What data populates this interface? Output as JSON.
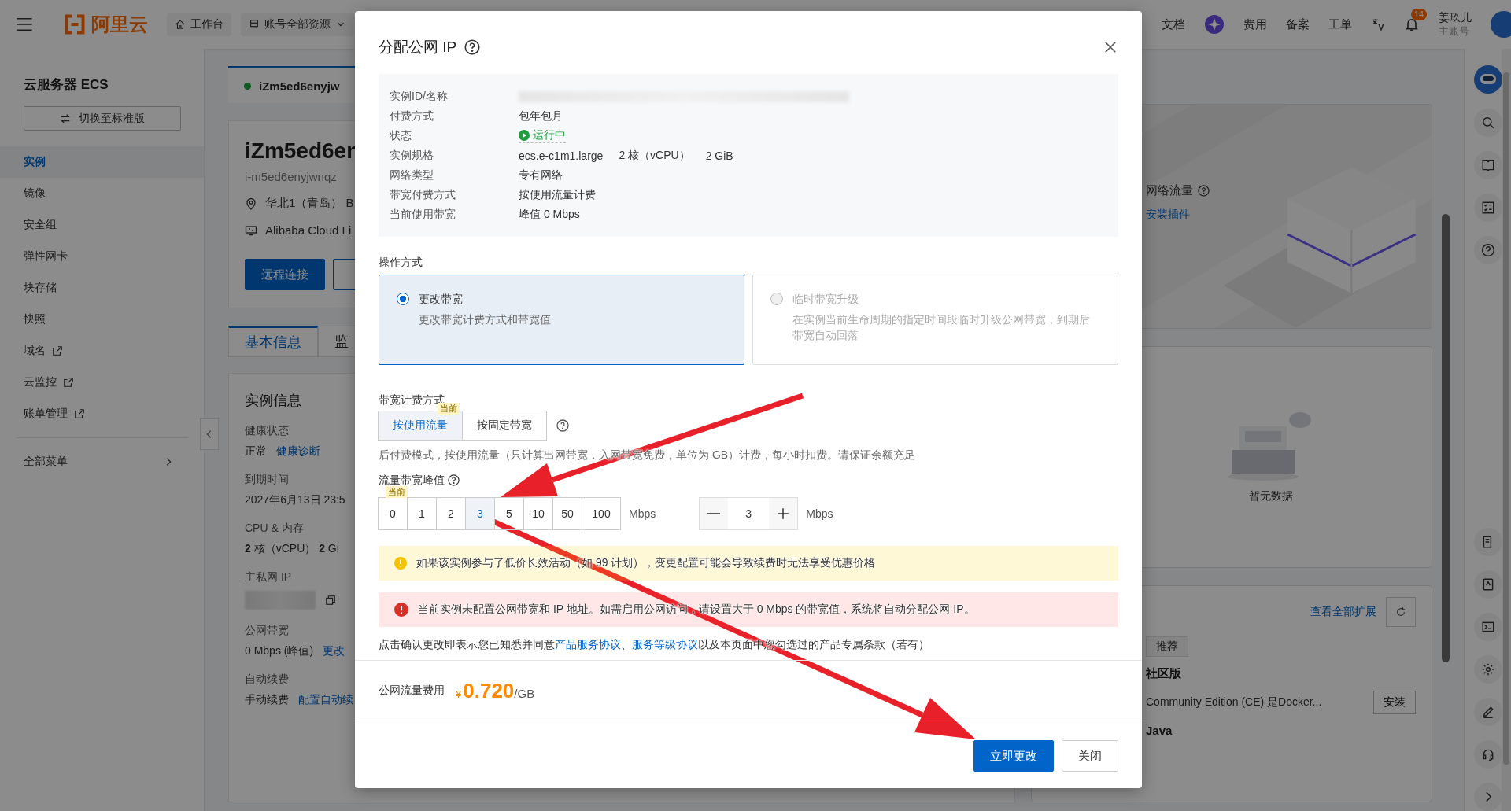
{
  "topbar": {
    "logo": "阿里云",
    "nav": [
      {
        "label": "工作台",
        "kind": "home"
      },
      {
        "label": "账号全部资源",
        "kind": "resources"
      }
    ],
    "links": [
      "文档",
      "费用",
      "备案",
      "工单"
    ],
    "notification_count": "14",
    "user": {
      "name": "姜玖儿",
      "role": "主账号"
    }
  },
  "sidebar": {
    "title": "云服务器 ECS",
    "switch_button": "切换至标准版",
    "items": [
      {
        "label": "实例",
        "selected": true,
        "external": false
      },
      {
        "label": "镜像",
        "selected": false,
        "external": false
      },
      {
        "label": "安全组",
        "selected": false,
        "external": false
      },
      {
        "label": "弹性网卡",
        "selected": false,
        "external": false
      },
      {
        "label": "块存储",
        "selected": false,
        "external": false
      },
      {
        "label": "快照",
        "selected": false,
        "external": false
      },
      {
        "label": "域名",
        "selected": false,
        "external": true
      },
      {
        "label": "云监控",
        "selected": false,
        "external": true
      },
      {
        "label": "账单管理",
        "selected": false,
        "external": true
      }
    ],
    "all_menu": "全部菜单"
  },
  "instance": {
    "tab_title": "iZm5ed6enyjw",
    "name": "iZm5ed6en",
    "id": "i-m5ed6enyjwnqz",
    "region": "华北1（青岛） B",
    "os": "Alibaba Cloud Li",
    "connect_button": "远程连接",
    "tabs": [
      {
        "label": "基本信息",
        "selected": true
      },
      {
        "label": "监",
        "selected": false
      }
    ],
    "info": {
      "title": "实例信息",
      "fields": [
        {
          "label": "健康状态",
          "value": "正常",
          "link": "健康诊断"
        },
        {
          "label": "到期时间",
          "value": "2027年6月13日 23:5"
        },
        {
          "label": "CPU & 内存",
          "value": "**2** 核（vCPU）  **2** Gi"
        },
        {
          "label": "主私网 IP",
          "kind": "blurred"
        },
        {
          "label": "公网带宽",
          "value": "0 Mbps (峰值)",
          "link": "更改"
        },
        {
          "label": "自动续费",
          "value": "手动续费",
          "link": "配置自动续"
        }
      ]
    }
  },
  "right": {
    "monitor": {
      "title": "网络流量",
      "link": "安装插件"
    },
    "empty": "暂无数据",
    "extensions": {
      "link": "查看全部扩展",
      "tag": "推荐",
      "items": [
        {
          "title": "社区版",
          "desc": "Community Edition (CE) 是Docker...",
          "button": "安装"
        },
        {
          "title": "Java"
        }
      ]
    }
  },
  "dialog": {
    "title": "分配公网 IP",
    "details": [
      {
        "label": "实例ID/名称",
        "kind": "blurred"
      },
      {
        "label": "付费方式",
        "values": [
          "包年包月"
        ]
      },
      {
        "label": "状态",
        "values": [
          "运行中"
        ],
        "kind": "status"
      },
      {
        "label": "实例规格",
        "values": [
          "ecs.e-c1m1.large",
          "2 核（vCPU）",
          "2 GiB"
        ]
      },
      {
        "label": "网络类型",
        "values": [
          "专有网络"
        ]
      },
      {
        "label": "带宽付费方式",
        "values": [
          "按使用流量计费"
        ]
      },
      {
        "label": "当前使用带宽",
        "values": [
          "峰值 0 Mbps"
        ]
      }
    ],
    "operation": {
      "label": "操作方式",
      "options": [
        {
          "title": "更改带宽",
          "desc": "更改带宽计费方式和带宽值",
          "selected": true,
          "disabled": false
        },
        {
          "title": "临时带宽升级",
          "desc": "在实例当前生命周期的指定时间段临时升级公网带宽，到期后带宽自动回落",
          "selected": false,
          "disabled": true
        }
      ]
    },
    "billing": {
      "label": "带宽计费方式",
      "options": [
        {
          "label": "按使用流量",
          "selected": true,
          "badge": "当前"
        },
        {
          "label": "按固定带宽",
          "selected": false
        }
      ],
      "note": "后付费模式，按使用流量（只计算出网带宽，入网带宽免费，单位为 GB）计费，每小时扣费。请保证余额充足"
    },
    "bandwidth": {
      "label": "流量带宽峰值",
      "options": [
        {
          "label": "0",
          "selected": false,
          "badge": "当前"
        },
        {
          "label": "1",
          "selected": false
        },
        {
          "label": "2",
          "selected": false
        },
        {
          "label": "3",
          "selected": true
        },
        {
          "label": "5",
          "selected": false
        },
        {
          "label": "10",
          "selected": false
        },
        {
          "label": "50",
          "selected": false
        },
        {
          "label": "100",
          "selected": false
        }
      ],
      "unit": "Mbps",
      "stepper": {
        "value": "3",
        "unit": "Mbps"
      }
    },
    "alerts": [
      {
        "kind": "warning",
        "text": "如果该实例参与了低价长效活动（如 99 计划），变更配置可能会导致续费时无法享受优惠价格"
      },
      {
        "kind": "error",
        "text": "当前实例未配置公网带宽和 IP 地址。如需启用公网访问，请设置大于 0 Mbps 的带宽值，系统将自动分配公网 IP。"
      }
    ],
    "agreement": [
      {
        "kind": "text",
        "text": "点击确认更改即表示您已知悉并同意"
      },
      {
        "kind": "link",
        "text": "产品服务协议"
      },
      {
        "kind": "text",
        "text": "、"
      },
      {
        "kind": "link",
        "text": "服务等级协议"
      },
      {
        "kind": "text",
        "text": "以及本页面中您勾选过的产品专属条款（若有）"
      }
    ],
    "fee": {
      "label": "公网流量费用",
      "currency": "¥",
      "amount": "0.720",
      "unit": "/GB"
    },
    "buttons": [
      {
        "label": "立即更改",
        "kind": "primary"
      },
      {
        "label": "关闭",
        "kind": "default"
      }
    ]
  }
}
